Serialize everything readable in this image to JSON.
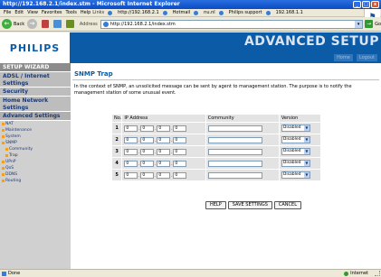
{
  "window": {
    "title": "http://192.168.2.1/index.stm - Microsoft Internet Explorer",
    "min_label": "_",
    "max_label": "□",
    "close_label": "x"
  },
  "menu": {
    "items": [
      "File",
      "Edit",
      "View",
      "Favorites",
      "Tools",
      "Help"
    ],
    "links_label": "Links",
    "links": [
      "http://192.168.2.1",
      "Hotmail",
      "nu.nl",
      "Philips support",
      "192.168.1.1"
    ]
  },
  "toolbar": {
    "back_label": "Back",
    "back_glyph": "←",
    "forward_glyph": "→",
    "address_label": "Address",
    "address_value": "http://192.168.2.1/index.stm",
    "dropdown_glyph": "▾",
    "go_glyph": "→",
    "go_label": "Go"
  },
  "header": {
    "logo": "PHILIPS",
    "title": "ADVANCED SETUP",
    "home_link": "Home",
    "logout_link": "Logout"
  },
  "sidebar": {
    "setup_wizard": "SETUP WIZARD",
    "adsl_internet": "ADSL / Internet Settings",
    "security": "Security",
    "home_network": "Home Network Settings",
    "advanced": "Advanced Settings",
    "items": [
      {
        "label": "NAT",
        "sub": false
      },
      {
        "label": "Maintenance",
        "sub": false
      },
      {
        "label": "System",
        "sub": false
      },
      {
        "label": "SNMP",
        "sub": false
      },
      {
        "label": "Community",
        "sub": true
      },
      {
        "label": "Trap",
        "sub": true
      },
      {
        "label": "UPnP",
        "sub": false
      },
      {
        "label": "QoS",
        "sub": false
      },
      {
        "label": "DDNS",
        "sub": false
      },
      {
        "label": "Routing",
        "sub": false
      }
    ]
  },
  "content": {
    "title": "SNMP Trap",
    "description": "In the context of SNMP, an unsolicited message can be sent by agent to management station. The purpose is to notify the management station of some unusual event.",
    "table": {
      "headers": [
        "No.",
        "IP Address",
        "Community",
        "Version"
      ],
      "rows": [
        {
          "no": "1",
          "ip": [
            "0",
            "0",
            "0",
            "0"
          ],
          "community": "",
          "version": "Disabled"
        },
        {
          "no": "2",
          "ip": [
            "0",
            "0",
            "0",
            "0"
          ],
          "community": "",
          "version": "Disabled"
        },
        {
          "no": "3",
          "ip": [
            "0",
            "0",
            "0",
            "0"
          ],
          "community": "",
          "version": "Disabled"
        },
        {
          "no": "4",
          "ip": [
            "0",
            "0",
            "0",
            "0"
          ],
          "community": "",
          "version": "Disabled"
        },
        {
          "no": "5",
          "ip": [
            "0",
            "0",
            "0",
            "0"
          ],
          "community": "",
          "version": "Disabled"
        }
      ]
    },
    "buttons": {
      "help": "HELP",
      "save": "SAVE SETTINGS",
      "cancel": "CANCEL"
    }
  },
  "status": {
    "left": "Done",
    "right": "Internet"
  }
}
